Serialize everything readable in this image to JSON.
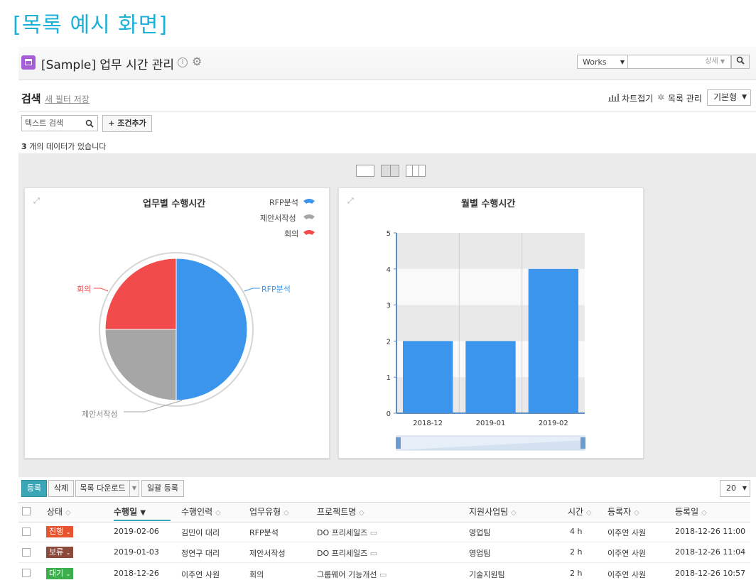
{
  "caption": "[목록 예시 화면]",
  "app": {
    "title": "[Sample] 업무 시간 관리",
    "info_icon": "i",
    "gear_icon": "gear-icon"
  },
  "search_bar": {
    "scope": "Works",
    "detail_label": "상세",
    "search_icon": "search-icon"
  },
  "filter": {
    "title": "검색",
    "save_filter": "새 필터 저장",
    "chart_collapse": "차트접기",
    "list_manage": "목록 관리",
    "view_mode": "기본형",
    "text_search_placeholder": "텍스트 검색",
    "add_condition": "+ 조건추가"
  },
  "count": {
    "number": "3",
    "suffix": "개의 데이터가 있습니다"
  },
  "pie_chart": {
    "title": "업무별 수행시간",
    "legend": [
      "RFP분석",
      "제안서작성",
      "회의"
    ],
    "labels": {
      "rfp": "RFP분석",
      "proposal": "제안서작성",
      "meeting": "회의"
    }
  },
  "bar_chart_panel": {
    "title": "월별 수행시간"
  },
  "chart_data": [
    {
      "type": "pie",
      "title": "업무별 수행시간",
      "categories": [
        "RFP분석",
        "제안서작성",
        "회의"
      ],
      "values": [
        4,
        2,
        2
      ],
      "colors": [
        "#3b95ec",
        "#a6a6a6",
        "#f24b4b"
      ],
      "legend": "top-right"
    },
    {
      "type": "bar",
      "title": "월별 수행시간",
      "categories": [
        "2018-12",
        "2019-01",
        "2019-02"
      ],
      "values": [
        2,
        2,
        4
      ],
      "ylim": [
        0,
        5
      ],
      "yticks": [
        "0",
        "1",
        "2",
        "3",
        "4",
        "5"
      ],
      "color": "#3b95ec",
      "grid": true
    }
  ],
  "actions": {
    "register": "등록",
    "delete": "삭제",
    "download": "목록 다운로드",
    "bulk_register": "일괄 등록",
    "page_size": "20"
  },
  "table": {
    "headers": {
      "status": "상태",
      "date": "수행일",
      "person": "수행인력",
      "type": "업무유형",
      "project": "프로젝트명",
      "team": "지원사업팀",
      "hours": "시간",
      "registrant": "등록자",
      "reg_date": "등록일"
    },
    "rows": [
      {
        "status": "진행",
        "status_color": "#e8532f",
        "date": "2019-02-06",
        "person": "김민이 대리",
        "type": "RFP분석",
        "project": "DO 프리세일즈",
        "team": "영업팀",
        "hours": "4 h",
        "registrant": "이주연 사원",
        "reg_date": "2018-12-26 11:00"
      },
      {
        "status": "보류",
        "status_color": "#8b4a3a",
        "date": "2019-01-03",
        "person": "정연구 대리",
        "type": "제안서작성",
        "project": "DO 프리세일즈",
        "team": "영업팀",
        "hours": "2 h",
        "registrant": "이주연 사원",
        "reg_date": "2018-12-26 11:04"
      },
      {
        "status": "대기",
        "status_color": "#3cae4e",
        "date": "2018-12-26",
        "person": "이주연 사원",
        "type": "회의",
        "project": "그룹웨어 기능개선",
        "team": "기술지원팀",
        "hours": "2 h",
        "registrant": "이주연 사원",
        "reg_date": "2018-12-26 10:57"
      }
    ]
  }
}
